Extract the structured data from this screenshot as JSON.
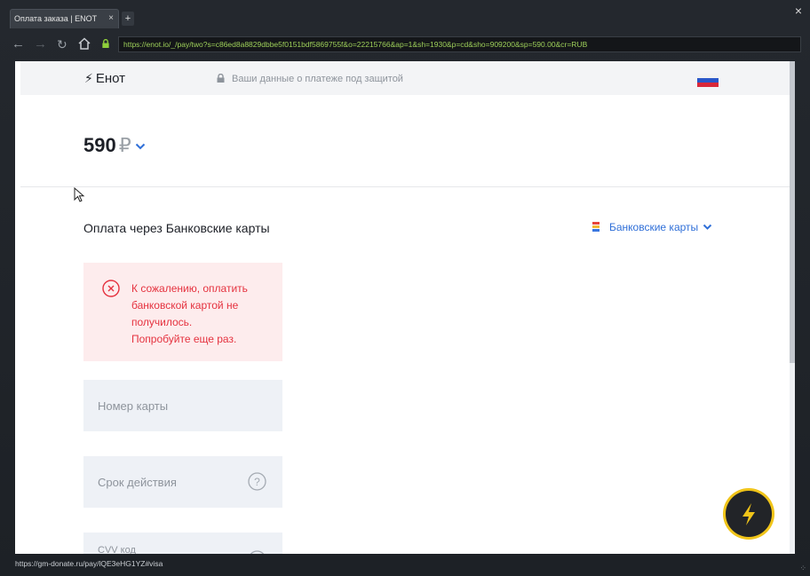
{
  "browser": {
    "tab_title": "Оплата заказа | ENOT",
    "tab_close": "×",
    "new_tab": "+",
    "window_close": "×",
    "url": "https://enot.io/_/pay/two?s=c86ed8a8829dbbe5f0151bdf5869755f&o=22215766&ap=1&sh=1930&p=cd&sho=909200&sp=590.00&cr=RUB",
    "status_url": "https://gm-donate.ru/pay/lQE3eHG1YZ#visa"
  },
  "header": {
    "logo": "Енот",
    "secure_text": "Ваши данные о платеже под защитой"
  },
  "amount": {
    "value": "590",
    "currency": "₽"
  },
  "payment": {
    "title": "Оплата через Банковские карты",
    "method_selector": "Банковские карты"
  },
  "error": {
    "line1": "К сожалению, оплатить",
    "line2": "банковской картой не",
    "line3": "получилось.",
    "line4": "Попробуйте еще раз."
  },
  "form": {
    "card_number_placeholder": "Номер карты",
    "expiry_placeholder": "Срок действия",
    "cvv_label": "CVV код"
  },
  "colors": {
    "accent": "#2f6fd8",
    "error": "#e5323f",
    "fab_ring": "#f0c419"
  }
}
